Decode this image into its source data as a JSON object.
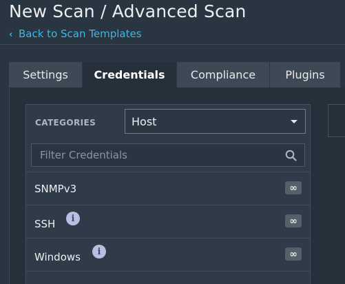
{
  "header": {
    "title": "New Scan / Advanced Scan",
    "back_link": "Back to Scan Templates"
  },
  "tabs": [
    {
      "label": "Settings",
      "active": false
    },
    {
      "label": "Credentials",
      "active": true
    },
    {
      "label": "Compliance",
      "active": false
    },
    {
      "label": "Plugins",
      "active": false
    }
  ],
  "credentials": {
    "categories_label": "CATEGORIES",
    "category_selected": "Host",
    "filter_placeholder": "Filter Credentials",
    "items": [
      {
        "label": "SNMPv3",
        "info_icon": false,
        "badge": "∞"
      },
      {
        "label": "SSH",
        "info_icon": true,
        "badge": "∞"
      },
      {
        "label": "Windows",
        "info_icon": true,
        "badge": "∞"
      }
    ]
  },
  "colors": {
    "background": "#2a3542",
    "active_tab": "#26303b",
    "link": "#3fb6e5",
    "info_icon": "#b7c0e2"
  }
}
